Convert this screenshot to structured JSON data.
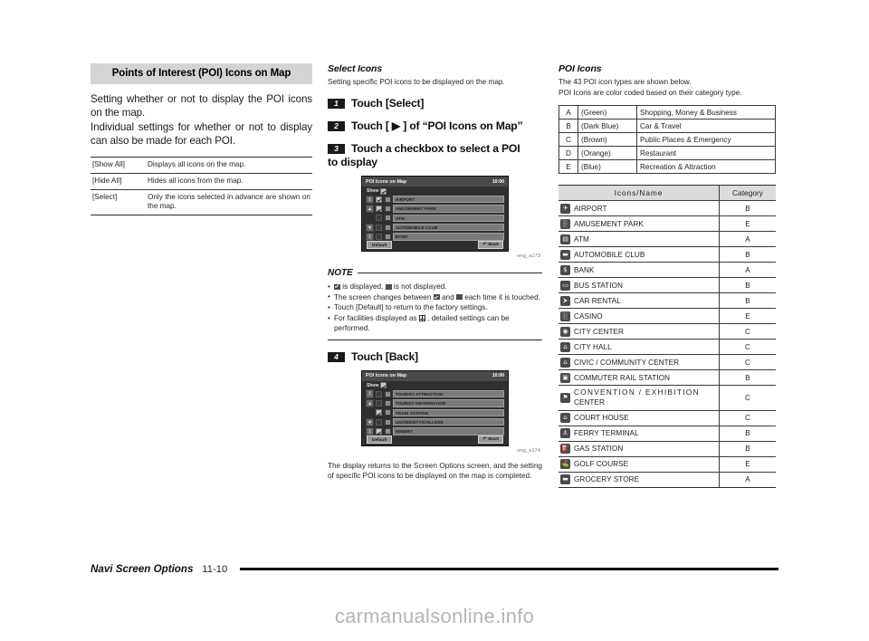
{
  "left": {
    "heading": "Points of Interest (POI) Icons on Map",
    "paragraph1": "Setting whether or not to display the POI icons on the map.",
    "paragraph2": "Individual settings for whether or not to display can also be made for each POI.",
    "options": [
      {
        "key": "[Show All]",
        "desc": "Displays all icons on the map."
      },
      {
        "key": "[Hide All]",
        "desc": "Hides all icons from the map."
      },
      {
        "key": "[Select]",
        "desc": "Only the icons selected in advance are shown on the map."
      }
    ]
  },
  "mid": {
    "heading": "Select Icons",
    "lead": "Setting specific POI icons to be displayed on the map.",
    "steps": [
      {
        "num": "1",
        "text": "Touch [Select]"
      },
      {
        "num": "2",
        "text": "Touch [ ▶ ] of “POI Icons on Map”"
      },
      {
        "num": "3",
        "text": "Touch a checkbox to select a POI",
        "text2": "to display"
      },
      {
        "num": "4",
        "text": "Touch [Back]"
      }
    ],
    "screen1": {
      "title": "POI Icons on Map",
      "time": "10:00",
      "show_label": "Show",
      "show_checked": true,
      "scroll_buttons": [
        "↥",
        "▲",
        "▼",
        "↧"
      ],
      "rows": [
        {
          "label": "AIRPORT",
          "checked": true
        },
        {
          "label": "AMUSEMENT PARK",
          "checked": true
        },
        {
          "label": "ATM",
          "checked": false
        },
        {
          "label": "AUTOMOBILE CLUB",
          "checked": false
        },
        {
          "label": "BANK",
          "checked": false
        }
      ],
      "default_label": "Default",
      "back_label": "Back",
      "caption": "eng_a173"
    },
    "screen2": {
      "title": "POI Icons on Map",
      "time": "10:00",
      "show_label": "Show",
      "show_checked": true,
      "scroll_buttons": [
        "↥",
        "▲",
        "▼",
        "↧"
      ],
      "rows": [
        {
          "label": "TOURIST ATTRACTION",
          "checked": false
        },
        {
          "label": "TOURIST INFORMATION",
          "checked": false
        },
        {
          "label": "TRAIN STATION",
          "checked": true
        },
        {
          "label": "UNIVERSITY/COLLEGE",
          "checked": false
        },
        {
          "label": "WINERY",
          "checked": true
        }
      ],
      "default_label": "Default",
      "back_label": "Back",
      "caption": "eng_a174"
    },
    "note": {
      "title": "NOTE",
      "items": [
        {
          "pre": "",
          "mid": " is displayed, ",
          "post": " is not displayed."
        },
        {
          "pre": "The screen changes between ",
          "mid": " and ",
          "post": " each time it is touched."
        },
        {
          "plain": "Touch [Default] to return to the factory settings."
        },
        {
          "pre2": "For facilities displayed as ",
          "post2": " , detailed settings can be performed."
        }
      ]
    },
    "closing": "The display returns to the Screen Options screen, and the setting of specific POI icons to be displayed on the map is completed."
  },
  "right": {
    "heading": "POI Icons",
    "lead1": "The 43 POI icon types are shown below.",
    "lead2": "POI Icons are color coded based on their category type.",
    "categories": [
      {
        "letter": "A",
        "color": "(Green)",
        "desc": "Shopping, Money & Business"
      },
      {
        "letter": "B",
        "color": "(Dark Blue)",
        "desc": "Car & Travel"
      },
      {
        "letter": "C",
        "color": "(Brown)",
        "desc": "Public Places & Emergency"
      },
      {
        "letter": "D",
        "color": "(Orange)",
        "desc": "Restaurant"
      },
      {
        "letter": "E",
        "color": "(Blue)",
        "desc": "Recreation & Attraction"
      }
    ],
    "table_headers": {
      "icons_name": "Icons/Name",
      "category": "Category"
    },
    "poi_rows": [
      {
        "icon": "airport-icon",
        "glyph": "✈",
        "name": "AIRPORT",
        "category": "B"
      },
      {
        "icon": "amusement-park-icon",
        "glyph": "░",
        "name": "AMUSEMENT PARK",
        "category": "E"
      },
      {
        "icon": "atm-icon",
        "glyph": "▤",
        "name": "ATM",
        "category": "A"
      },
      {
        "icon": "automobile-club-icon",
        "glyph": "▬",
        "name": "AUTOMOBILE CLUB",
        "category": "B"
      },
      {
        "icon": "bank-icon",
        "glyph": "$",
        "name": "BANK",
        "category": "A"
      },
      {
        "icon": "bus-station-icon",
        "glyph": "▭",
        "name": "BUS STATION",
        "category": "B"
      },
      {
        "icon": "car-rental-icon",
        "glyph": "⮞",
        "name": "CAR RENTAL",
        "category": "B"
      },
      {
        "icon": "casino-icon",
        "glyph": "░",
        "name": "CASINO",
        "category": "E"
      },
      {
        "icon": "city-center-icon",
        "glyph": "◉",
        "name": "CITY CENTER",
        "category": "C"
      },
      {
        "icon": "city-hall-icon",
        "glyph": "⌂",
        "name": "CITY HALL",
        "category": "C"
      },
      {
        "icon": "civic-community-center-icon",
        "glyph": "⌂",
        "name": "CIVIC / COMMUNITY CENTER",
        "category": "C"
      },
      {
        "icon": "commuter-rail-station-icon",
        "glyph": "▣",
        "name": "COMMUTER RAIL STATION",
        "category": "B"
      },
      {
        "icon": "convention-exhibition-center-icon",
        "glyph": "⚑",
        "name": "CONVENTION / EXHIBITION",
        "name2": "CENTER",
        "category": "C",
        "spread": true
      },
      {
        "icon": "court-house-icon",
        "glyph": "⌂",
        "name": "COURT HOUSE",
        "category": "C"
      },
      {
        "icon": "ferry-terminal-icon",
        "glyph": "⚓",
        "name": "FERRY TERMINAL",
        "category": "B"
      },
      {
        "icon": "gas-station-icon",
        "glyph": "⛽",
        "name": "GAS STATION",
        "category": "B"
      },
      {
        "icon": "golf-course-icon",
        "glyph": "⛳",
        "name": "GOLF COURSE",
        "category": "E"
      },
      {
        "icon": "grocery-store-icon",
        "glyph": "▬",
        "name": "GROCERY STORE",
        "category": "A"
      }
    ]
  },
  "footer": {
    "title": "Navi Screen Options",
    "page": "11-10"
  },
  "watermark": "carmanualsonline.info"
}
